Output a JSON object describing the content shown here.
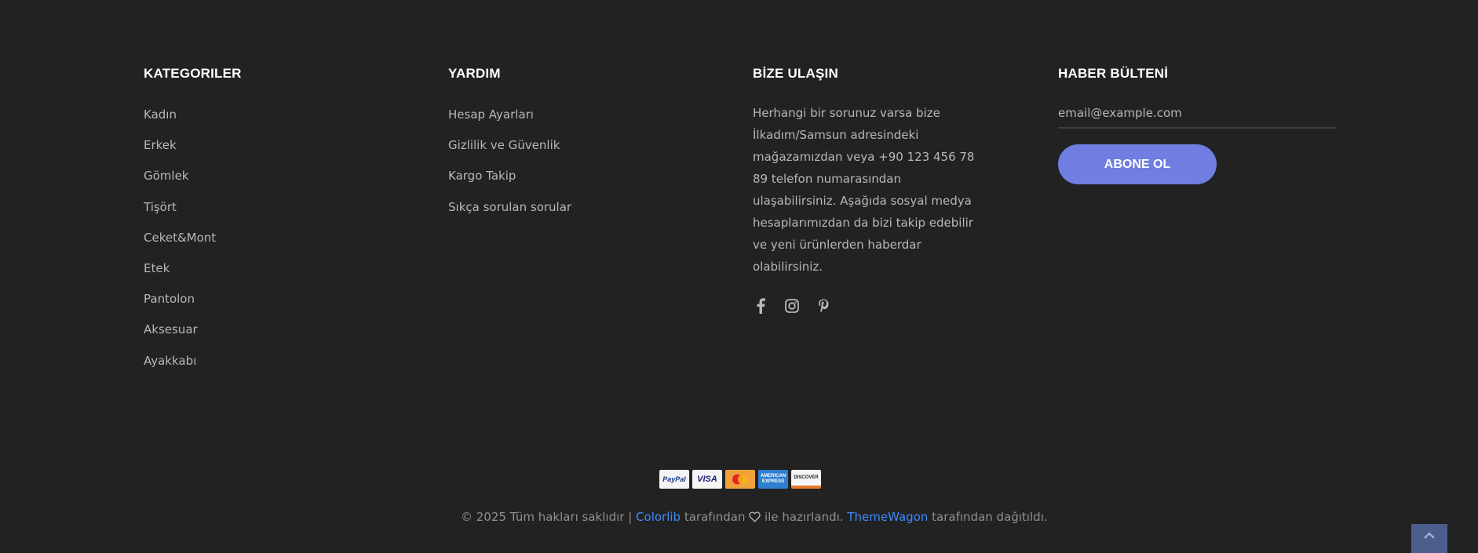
{
  "categories": {
    "title": "KATEGORILER",
    "items": [
      "Kadın",
      "Erkek",
      "Gömlek",
      "Tişört",
      "Ceket&Mont",
      "Etek",
      "Pantolon",
      "Aksesuar",
      "Ayakkabı"
    ]
  },
  "help": {
    "title": "YARDIM",
    "items": [
      "Hesap Ayarları",
      "Gizlilik ve Güvenlik",
      "Kargo Takip",
      "Sıkça sorulan sorular"
    ]
  },
  "contact": {
    "title": "BİZE ULAŞIN",
    "text": "Herhangi bir sorunuz varsa bize İlkadım/Samsun adresindeki mağazamızdan veya +90 123 456 78 89 telefon numarasından ulaşabilirsiniz. Aşağıda sosyal medya hesaplarımızdan da bizi takip edebilir ve yeni ürünlerden haberdar olabilirsiniz.",
    "social_icons": [
      "facebook-icon",
      "instagram-icon",
      "pinterest-icon"
    ]
  },
  "newsletter": {
    "title": "HABER BÜLTENİ",
    "email_placeholder": "email@example.com",
    "subscribe_label": "ABONE OL"
  },
  "payments": {
    "paypal": "PayPal",
    "visa": "VISA",
    "amex": "AMERICAN EXPRESS",
    "discover": "DISCOVER"
  },
  "copyright": {
    "prefix": "© 2025 Tüm hakları saklıdır |",
    "colorlib": "Colorlib",
    "middle": "tarafından",
    "made": "ile hazırlandı.",
    "themewagon": "ThemeWagon",
    "suffix": "tarafından dağıtıldı."
  },
  "colors": {
    "background": "#222222",
    "accent": "#6f7ee0",
    "link": "#3d8bfd",
    "back_to_top": "#4d5d8c"
  }
}
